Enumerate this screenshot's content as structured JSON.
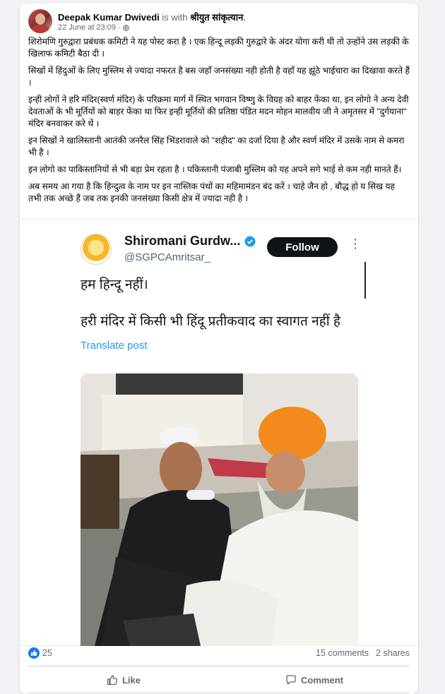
{
  "post": {
    "author": "Deepak Kumar Dwivedi",
    "with_text": " is with ",
    "tagged": "श्रीयुत सांकृत्यान",
    "tagged_suffix": ".",
    "timestamp": "22 June at 23:09",
    "meta_sep": " · ",
    "paragraphs": [
      "शिरोमणि गुरुद्वारा प्रबंधक कमिटी ने यह पोस्ट करा है । एक हिन्दू लड़की गुरुद्वारे के अंदर योगा करी थी तो उन्होंने उस लड़की के खिलाफ कमिटी बैठा दी ।",
      "सिखों में हिंदुओं के लिए मुस्लिम से ज्यादा नफरत है बस जहाँ जनसंख्या नही होती है वहाँ यह झूंठे भाईचारा का दिखावा करते हैं ।",
      " इन्ही लोगों ने हरि मंदिर(स्वर्ण मंदिर) के परिक्रमा मार्ग में स्थित भगवान विष्णु के विग्रह को बाहर फेंका था, इन लोगो ने अन्य देवी देवताओं के भी मूर्तियों को बाहर फेंका था फिर इन्ही मूर्तियों की प्रतिष्ठा पंडित मदन मोहन मालवीय जी ने अमृतसर में \"दुर्गयाना\" मंदिर बनवाकर करे थें ।",
      "इन सिखों ने खालिस्तानी आतंकी जनरैल सिंह भिंडरावाले को \"शहीद\" का दर्जा दिया है और स्वर्ण मंदिर में उसके नाम से कमरा भी है ।",
      " इन लोगो का पाकिस्तानियों से भी बड़ा प्रेम रहता है । पकिस्तानी पंजाबी मुस्लिम को यह अपने सगे भाई से कम नही मानते हैं।",
      "अब समय आ गया है कि हिन्दुत्व के नाम पर इन नास्तिक पंथों का महिमामंडन बंद करें । चाहे जैन हो , बौद्ध हो य सिख यह तभी तक अच्छे हैं जब तक इनकी जनसंख्या किसी क्षेत्र में ज्यादा नही है ।"
    ]
  },
  "tweet": {
    "name": "Shiromani Gurdw...",
    "handle": "@SGPCAmritsar_",
    "follow_label": "Follow",
    "more": "⋮",
    "line1": "हम हिन्दू नहीं।",
    "line2": "हरी मंदिर में किसी भी हिंदू प्रतीकवाद का स्वागत नहीं है",
    "translate": "Translate post"
  },
  "engagement": {
    "reaction_count": "25",
    "comments": "15 comments",
    "shares": "2 shares"
  },
  "actions": {
    "like": "Like",
    "comment": "Comment"
  },
  "colors": {
    "fb_blue": "#1877f2",
    "twitter_blue": "#1d9bf0",
    "verified": "#1d9bf0"
  }
}
